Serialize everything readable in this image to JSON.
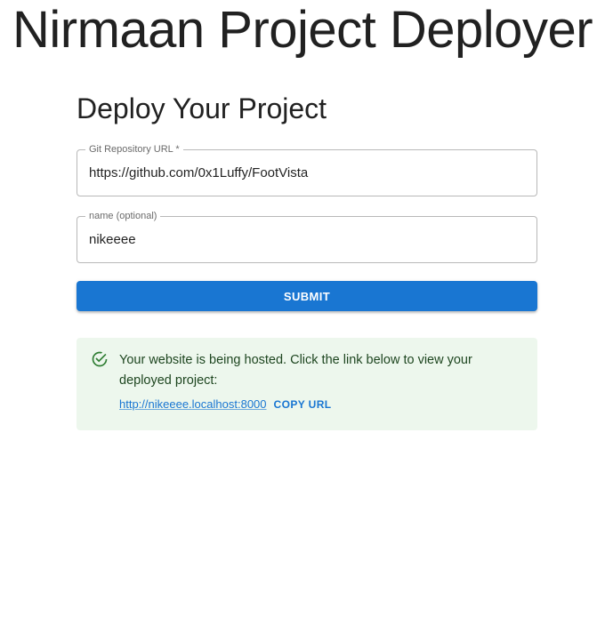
{
  "header": {
    "app_title": "Nirmaan Project Deployer"
  },
  "form": {
    "title": "Deploy Your Project",
    "repo_field": {
      "label": "Git Repository URL *",
      "value": "https://github.com/0x1Luffy/FootVista"
    },
    "name_field": {
      "label": "name (optional)",
      "value": "nikeeee"
    },
    "submit_label": "SUBMIT"
  },
  "alert": {
    "icon": "check-circle-icon",
    "message": "Your website is being hosted. Click the link below to view your deployed project:",
    "link_text": "http://nikeeee.localhost:8000",
    "copy_label": "COPY URL",
    "severity_color": "#2e7d32",
    "background_color": "#edf7ed"
  },
  "colors": {
    "primary": "#1976d2",
    "success_text": "#1e4620"
  }
}
